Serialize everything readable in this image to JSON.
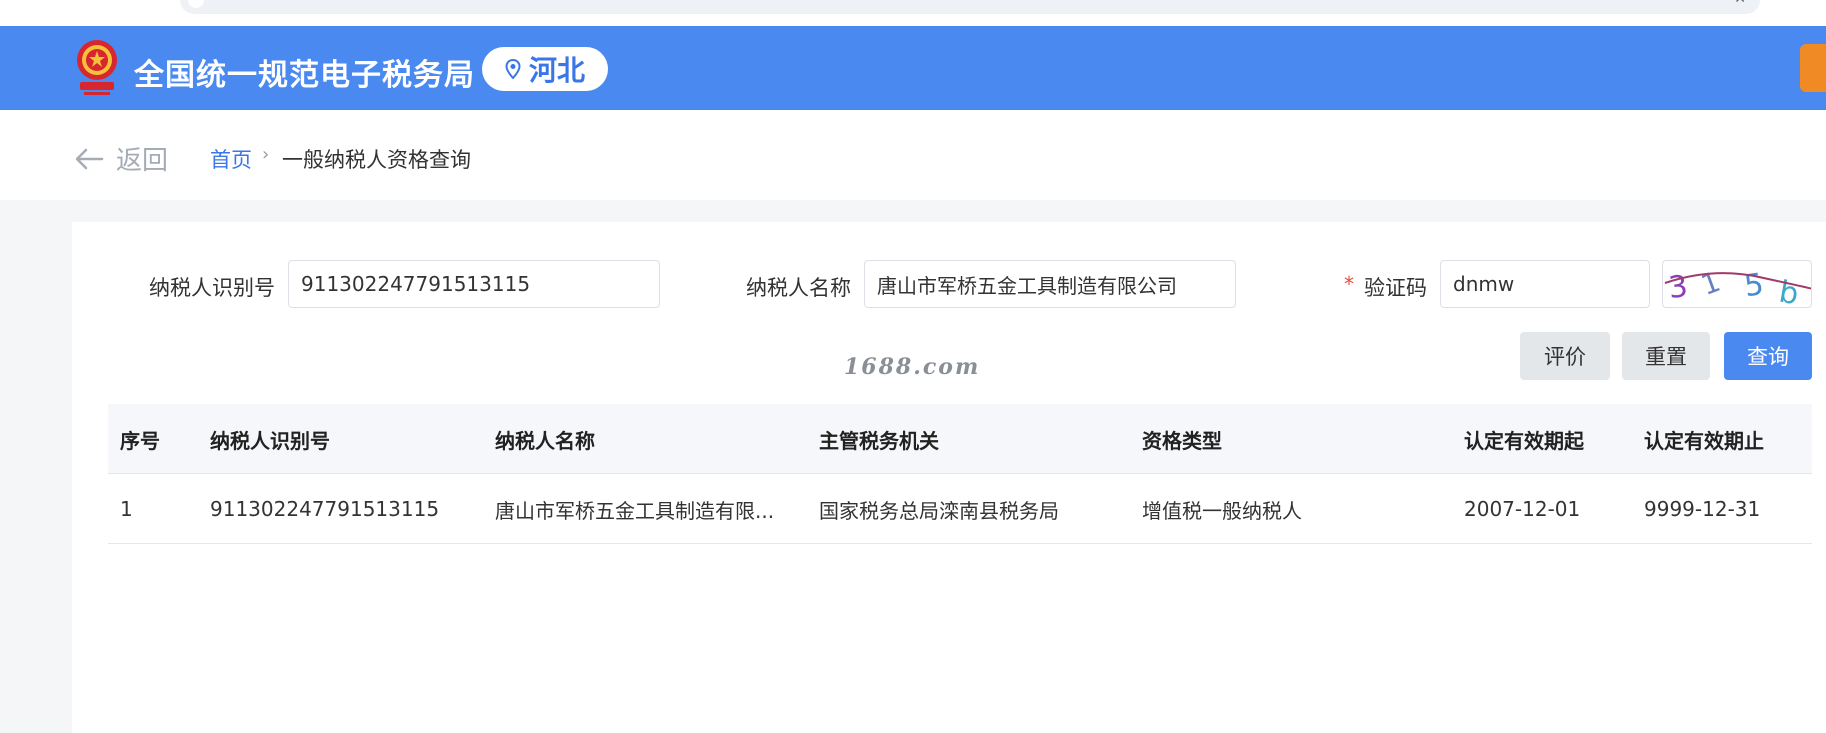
{
  "header": {
    "title": "全国统一规范电子税务局",
    "region": "河北"
  },
  "breadcrumb": {
    "back_label": "返回",
    "home": "首页",
    "separator": "›",
    "current": "一般纳税人资格查询"
  },
  "form": {
    "taxpayer_id_label": "纳税人识别号",
    "taxpayer_id_value": "911302247791513115",
    "taxpayer_name_label": "纳税人名称",
    "taxpayer_name_value": "唐山市军桥五金工具制造有限公司",
    "captcha_required_mark": "*",
    "captcha_label": "验证码",
    "captcha_value": "dnmw",
    "captcha_image_text": "315b"
  },
  "buttons": {
    "evaluate": "评价",
    "reset": "重置",
    "query": "查询"
  },
  "watermark": "1688.com",
  "table": {
    "columns": [
      "序号",
      "纳税人识别号",
      "纳税人名称",
      "主管税务机关",
      "资格类型",
      "认定有效期起",
      "认定有效期止"
    ],
    "rows": [
      [
        "1",
        "911302247791513115",
        "唐山市军桥五金工具制造有限...",
        "国家税务总局滦南县税务局",
        "增值税一般纳税人",
        "2007-12-01",
        "9999-12-31"
      ]
    ]
  },
  "colors": {
    "header_blue": "#4a89f0",
    "link_blue": "#3a76e8",
    "accent_orange": "#f08a24",
    "required_red": "#e74c3c"
  }
}
